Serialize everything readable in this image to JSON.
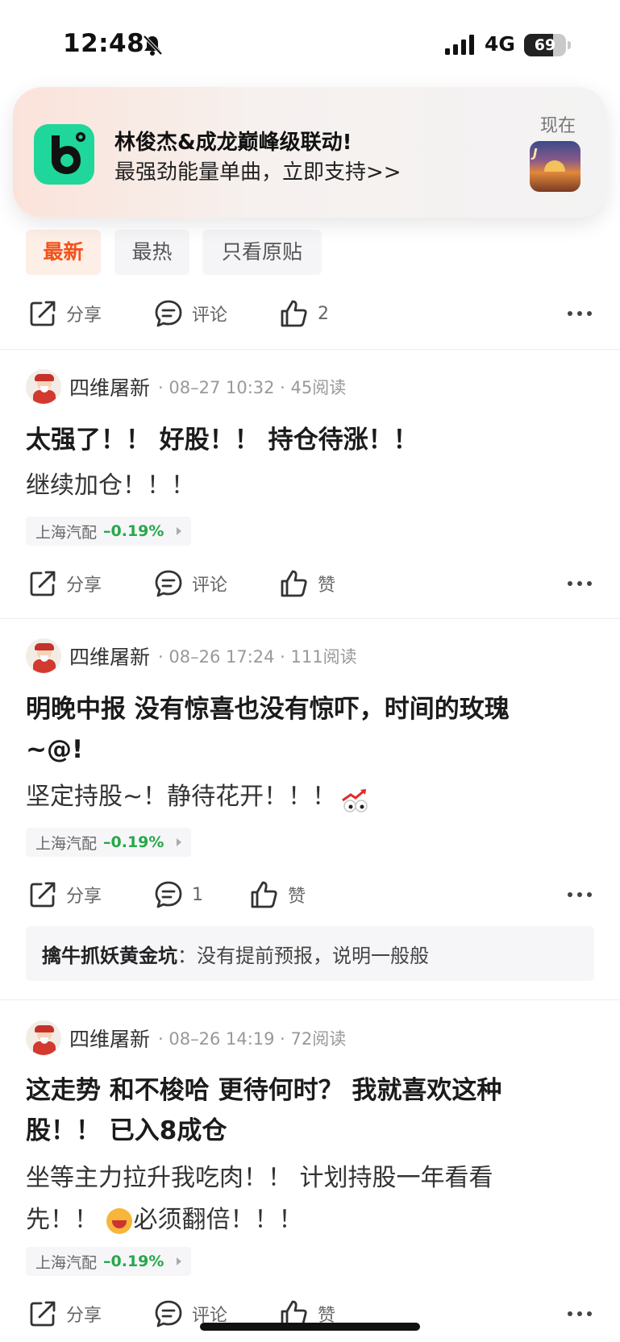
{
  "status_bar": {
    "time": "12:48",
    "network": "4G",
    "battery": "69",
    "battery_level": 0.69
  },
  "notification": {
    "title": "林俊杰&成龙巅峰级联动!",
    "body": "最强劲能量单曲，立即支持>>",
    "time": "现在",
    "thumb_text": "J"
  },
  "tabs": [
    {
      "label": "最新",
      "active": true
    },
    {
      "label": "最热",
      "active": false
    },
    {
      "label": "只看原贴",
      "active": false
    }
  ],
  "top_actions": {
    "share": "分享",
    "comment": "评论",
    "like": "2"
  },
  "posts": [
    {
      "author": "四维屠新",
      "meta": "· 08–27 10:32 · 45阅读",
      "title": "太强了！！ 好股！！ 持仓待涨！！",
      "body": "继续加仓！！！",
      "stock": {
        "name": "上海汽配",
        "change": "–0.19%"
      },
      "actions": {
        "share": "分享",
        "comment": "评论",
        "like": "赞"
      }
    },
    {
      "author": "四维屠新",
      "meta": "· 08–26 17:24 · 111阅读",
      "title_line1": "明晚中报 没有惊喜也没有惊吓，时间的玫瑰",
      "title_line2": "~@!",
      "body": "坚定持股~！静待花开！！！",
      "stock": {
        "name": "上海汽配",
        "change": "–0.19%"
      },
      "actions": {
        "share": "分享",
        "comment": "1",
        "like": "赞"
      },
      "reply": {
        "user": "擒牛抓妖黄金坑",
        "sep": "：",
        "text": "没有提前预报，说明一般般"
      }
    },
    {
      "author": "四维屠新",
      "meta": "· 08–26 14:19 · 72阅读",
      "title_line1": "这走势 和不梭哈 更待何时？ 我就喜欢这种",
      "title_line2": "股！！ 已入8成仓",
      "body_line1": "坐等主力拉升我吃肉！！ 计划持股一年看看",
      "body_line2_a": "先！！ ",
      "body_line2_b": "必须翻倍！！！",
      "stock": {
        "name": "上海汽配",
        "change": "–0.19%"
      },
      "actions": {
        "share": "分享",
        "comment": "评论",
        "like": "赞"
      }
    }
  ],
  "icons": {
    "share": "share-icon",
    "comment": "comment-icon",
    "like": "thumbs-up-icon",
    "more": "more-dots-icon"
  },
  "colors": {
    "accent": "#f2531a",
    "down_green": "#26a84a",
    "app_green": "#1fd79a"
  }
}
